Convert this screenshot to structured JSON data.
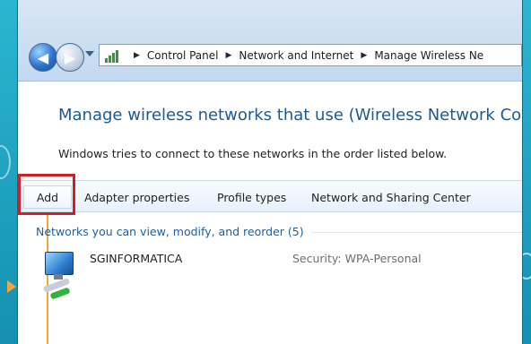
{
  "breadcrumbs": [
    "Control Panel",
    "Network and Internet",
    "Manage Wireless Ne"
  ],
  "page": {
    "title": "Manage wireless networks that use (Wireless Network Conn",
    "description": "Windows tries to connect to these networks in the order listed below."
  },
  "toolbar": {
    "add_label": "Add",
    "adapter_properties_label": "Adapter properties",
    "profile_types_label": "Profile types",
    "network_sharing_center_label": "Network and Sharing Center"
  },
  "networks": {
    "group_label": "Networks you can view, modify, and reorder (5)",
    "items": [
      {
        "name": "SGINFORMATICA",
        "security": "Security: WPA-Personal"
      }
    ]
  },
  "colors": {
    "accent_blue": "#1c5a94",
    "highlight_red": "#d11f26",
    "callout_orange": "#f3a63b",
    "background_teal": "#1fb0cb"
  },
  "icons": {
    "back": "back-arrow-icon",
    "forward": "forward-arrow-icon",
    "location": "network-signal-icon",
    "computer": "wireless-computer-icon"
  }
}
